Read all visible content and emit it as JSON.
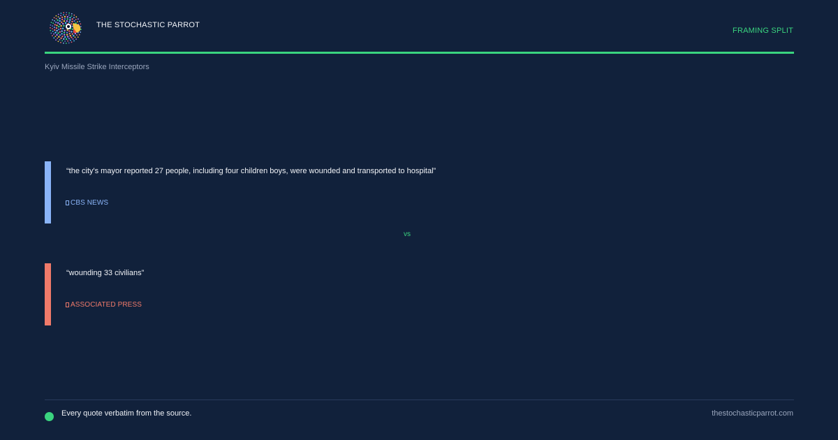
{
  "header": {
    "brand": "THE STOCHASTIC PARROT",
    "tag": "FRAMING SPLIT",
    "accent_color": "#3ad47f",
    "logo_icon": "parrot-logo-icon"
  },
  "topic": "Kyiv Missile Strike Interceptors",
  "quotes": [
    {
      "text": "“the city's mayor reported 27 people, including four children boys, were wounded and transported to hospital”",
      "source": "CBS NEWS",
      "source_icon": "source-icon",
      "color": "#8ab4f8"
    },
    {
      "text": "“wounding 33 civilians”",
      "source": "ASSOCIATED PRESS",
      "source_icon": "source-icon",
      "color": "#f07a6a"
    }
  ],
  "separator": "vs",
  "footer": {
    "note": "Every quote verbatim from the source.",
    "site": "thestochasticparrot.com"
  }
}
